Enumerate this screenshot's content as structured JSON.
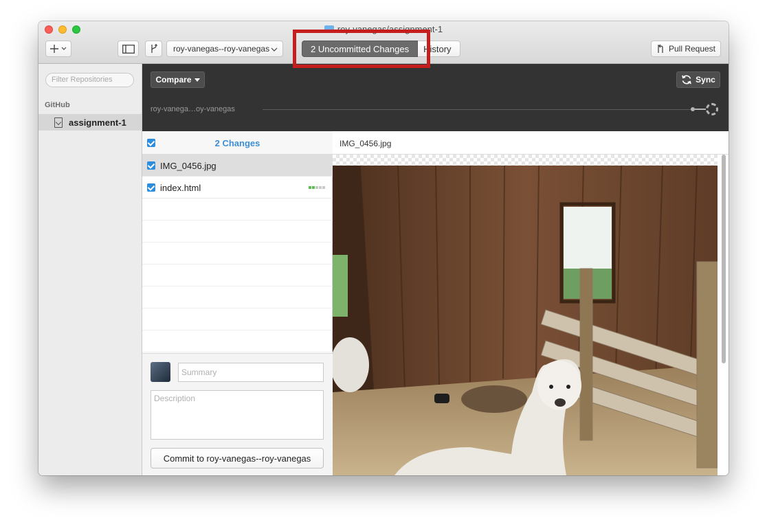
{
  "window": {
    "title": "roy-vanegas/assignment-1"
  },
  "toolbar": {
    "branch_label": "roy-vanegas--roy-vanegas",
    "uncommitted_label": "2 Uncommitted Changes",
    "history_label": "History",
    "pull_request_label": "Pull Request"
  },
  "sidebar": {
    "filter_placeholder": "Filter Repositories",
    "section_label": "GitHub",
    "repo_label": "assignment-1"
  },
  "compare_bar": {
    "compare_label": "Compare",
    "sync_label": "Sync",
    "branch_text": "roy-vanega…oy-vanegas"
  },
  "changes": {
    "count_label": "2 Changes",
    "files": [
      {
        "name": "IMG_0456.jpg",
        "checked": true,
        "selected": true
      },
      {
        "name": "index.html",
        "checked": true,
        "selected": false
      }
    ]
  },
  "commit": {
    "summary_placeholder": "Summary",
    "description_placeholder": "Description",
    "button_label": "Commit to roy-vanegas--roy-vanegas"
  },
  "preview": {
    "filename": "IMG_0456.jpg"
  },
  "colors": {
    "accent": "#2e8cdc",
    "highlight": "#c41e1e",
    "dark_bar": "#333333"
  },
  "icons": [
    "plus-icon",
    "chevron-down-icon",
    "sidebar-toggle-icon",
    "branch-icon",
    "pull-request-icon",
    "sync-icon",
    "repo-icon",
    "folder-icon"
  ]
}
